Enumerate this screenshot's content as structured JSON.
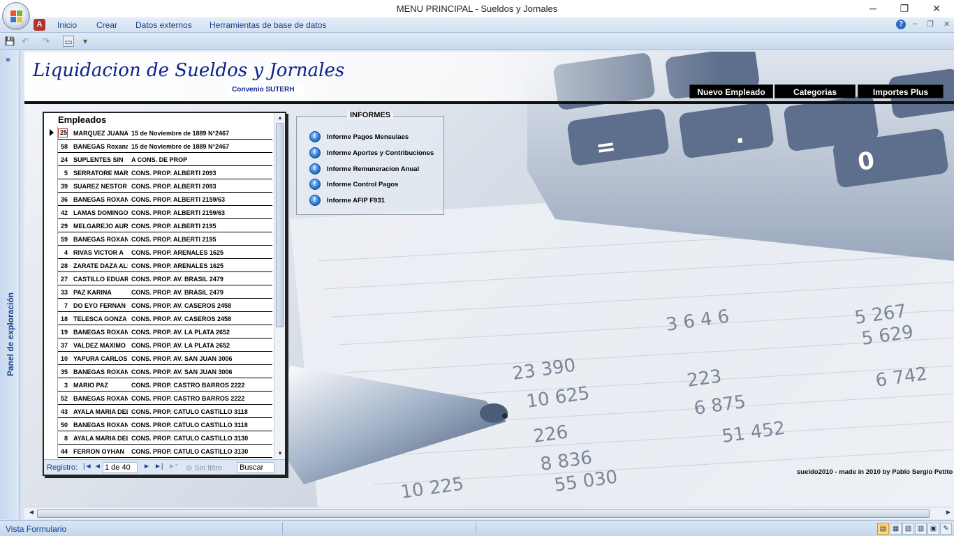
{
  "window": {
    "title": "MENU PRINCIPAL  -  Sueldos y Jornales",
    "minimize": "─",
    "restore": "❐",
    "close": "✕"
  },
  "ribbon": {
    "tabs": [
      "Inicio",
      "Crear",
      "Datos externos",
      "Herramientas de base de datos"
    ],
    "help": "?",
    "mini_min": "–",
    "mini_restore": "❐",
    "mini_close": "✕"
  },
  "qat": {
    "save": "💾",
    "undo": "↶",
    "redo": "↷",
    "print": "▭",
    "customize": "▾"
  },
  "navpane": {
    "toggle": "»",
    "label": "Panel de exploración"
  },
  "form": {
    "title": "Liquidacion de Sueldos y Jornales",
    "subtitle": "Convenio SUTERH",
    "buttons": [
      "Nuevo Empleado",
      "Categorias",
      "Importes Plus"
    ],
    "credit": "sueldo2010 - made in 2010 by Pablo Sergio Petito"
  },
  "empleados": {
    "title": "Empleados",
    "rows": [
      {
        "id": "25",
        "name": "MARQUEZ JUANA",
        "address": "15 de Noviembre de 1889 N°2467"
      },
      {
        "id": "58",
        "name": "BANEGAS Roxana",
        "address": "15 de Noviembre de 1889 N°2467"
      },
      {
        "id": "24",
        "name": "SUPLENTES SIN",
        "address": "A CONS. DE PROP"
      },
      {
        "id": "5",
        "name": "SERRATORE MAR",
        "address": "CONS. PROP. ALBERTI 2093"
      },
      {
        "id": "39",
        "name": "SUAREZ NESTOR",
        "address": "CONS. PROP. ALBERTI 2093"
      },
      {
        "id": "36",
        "name": "BANEGAS ROXAN",
        "address": "CONS. PROP. ALBERTI 2159/63"
      },
      {
        "id": "42",
        "name": "LAMAS DOMINGO",
        "address": "CONS. PROP. ALBERTI 2159/63"
      },
      {
        "id": "29",
        "name": "MELGAREJO AUR",
        "address": "CONS. PROP. ALBERTI 2195"
      },
      {
        "id": "59",
        "name": "BANEGAS ROXAN",
        "address": "CONS. PROP. ALBERTI 2195"
      },
      {
        "id": "4",
        "name": "RIVAS VICTOR A",
        "address": "CONS. PROP. ARENALES 1625"
      },
      {
        "id": "28",
        "name": "ZARATE DAZA ALI",
        "address": "CONS. PROP. ARENALES 1625"
      },
      {
        "id": "27",
        "name": "CASTILLO EDUAR",
        "address": "CONS. PROP. AV. BRASIL 2479"
      },
      {
        "id": "33",
        "name": "PAZ KARINA",
        "address": "CONS. PROP. AV. BRASIL 2479"
      },
      {
        "id": "7",
        "name": "DO EYO FERNAN",
        "address": "CONS. PROP. AV. CASEROS 2458"
      },
      {
        "id": "18",
        "name": "TELESCA GONZA",
        "address": "CONS. PROP. AV. CASEROS 2458"
      },
      {
        "id": "19",
        "name": "BANEGAS ROXAN",
        "address": "CONS. PROP. AV. LA PLATA 2652"
      },
      {
        "id": "37",
        "name": "VALDEZ MAXIMO",
        "address": "CONS. PROP. AV. LA PLATA 2652"
      },
      {
        "id": "10",
        "name": "YAPURA CARLOS",
        "address": "CONS. PROP. AV. SAN JUAN 3006"
      },
      {
        "id": "35",
        "name": "BANEGAS ROXAN",
        "address": "CONS. PROP. AV. SAN JUAN 3006"
      },
      {
        "id": "3",
        "name": "MARIO PAZ",
        "address": "CONS. PROP. CASTRO BARROS 2222"
      },
      {
        "id": "52",
        "name": "BANEGAS ROXAN",
        "address": "CONS. PROP. CASTRO BARROS 2222"
      },
      {
        "id": "43",
        "name": "AYALA MARIA DEL",
        "address": "CONS. PROP. CATULO CASTILLO 3118"
      },
      {
        "id": "50",
        "name": "BANEGAS ROXAN",
        "address": "CONS. PROP. CATULO CASTILLO 3118"
      },
      {
        "id": "8",
        "name": "AYALA MARIA DEL",
        "address": "CONS. PROP. CATULO CASTILLO 3130"
      },
      {
        "id": "44",
        "name": "FERRON OYHAN",
        "address": "CONS. PROP. CATULO CASTILLO 3130"
      }
    ],
    "record_nav": {
      "label": "Registro:",
      "first": "|◄",
      "prev": "◄",
      "count": "1 de 40",
      "next": "►",
      "last": "►|",
      "new": "►*",
      "filter": "Sin filtro",
      "search": "Buscar"
    }
  },
  "informes": {
    "title": "INFORMES",
    "items": [
      "Informe Pagos Mensulaes",
      "Informe Aportes y Contribuciones",
      "Informe Remuneracion Anual",
      "Informe Control Pagos",
      "Informe AFIP F931"
    ]
  },
  "status": {
    "text": "Vista Formulario"
  },
  "colors": {
    "title_blue": "#0c1f8c",
    "ribbon_text": "#15428b",
    "button_black": "#000000"
  }
}
